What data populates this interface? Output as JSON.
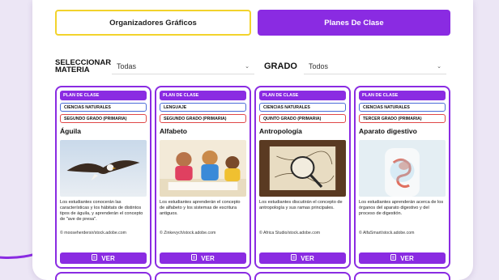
{
  "tabs": {
    "organizadores": "Organizadores Gráficos",
    "planes": "Planes De Clase"
  },
  "filters": {
    "materia_label": "SELECCIONAR MATERIA",
    "materia_value": "Todas",
    "grado_label": "GRADO",
    "grado_value": "Todos"
  },
  "cards": [
    {
      "type": "PLAN DE CLASE",
      "subject": "CIENCIAS NATURALES",
      "grade": "SEGUNDO GRADO (PRIMARIA)",
      "title": "Águila",
      "description": "Los estudiantes conocerán las características y los hábitats de distintos tipos de águila, y aprenderán el concepto de \"ave de presa\".",
      "credit": "© mooseherdersir/stock.adobe.com",
      "button": "VER"
    },
    {
      "type": "PLAN DE CLASE",
      "subject": "LENGUAJE",
      "grade": "SEGUNDO GRADO (PRIMARIA)",
      "title": "Alfabeto",
      "description": "Los estudiantes aprenderán el concepto de alfabeto y los sistemas de escritura antiguos.",
      "credit": "© Zinkevych/stock.adobe.com",
      "button": "VER"
    },
    {
      "type": "PLAN DE CLASE",
      "subject": "CIENCIAS NATURALES",
      "grade": "QUINTO GRADO (PRIMARIA)",
      "title": "Antropología",
      "description": "Los estudiantes discutirán el concepto de antropología y sus ramas principales.",
      "credit": "© Africa Studio/stock.adobe.com",
      "button": "VER"
    },
    {
      "type": "PLAN DE CLASE",
      "subject": "CIENCIAS NATURALES",
      "grade": "TERCER GRADO (PRIMARIA)",
      "title": "Aparato digestivo",
      "description": "Los estudiantes aprenderán acerca de los órganos del aparato digestivo y del proceso de digestión.",
      "credit": "© AlfaSmart/stock.adobe.com",
      "button": "VER"
    }
  ],
  "colors": {
    "accent": "#8a2be2",
    "tab_border": "#f2d32c",
    "subject_border": "#4a6bd8",
    "grade_border": "#e04848"
  }
}
